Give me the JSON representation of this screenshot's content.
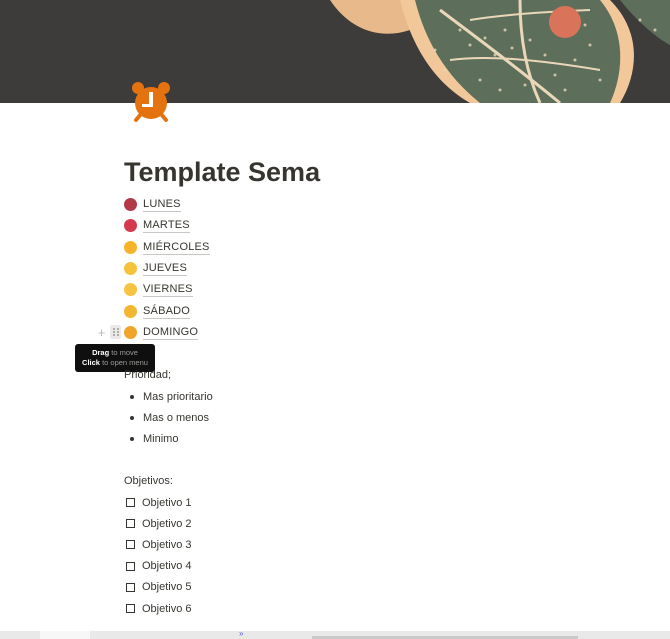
{
  "page": {
    "title": "Template Sema",
    "page_icon": "alarm-clock-icon"
  },
  "links": [
    {
      "label": "LUNES",
      "icon": "skull-emoji-icon",
      "color": "#b23a48"
    },
    {
      "label": "MARTES",
      "icon": "angry-face-emoji-icon",
      "color": "#d6384c"
    },
    {
      "label": "MIÉRCOLES",
      "icon": "hot-face-emoji-icon",
      "color": "#f7b32b"
    },
    {
      "label": "JUEVES",
      "icon": "relieved-face-emoji-icon",
      "color": "#f5c33b"
    },
    {
      "label": "VIERNES",
      "icon": "slightly-smiling-face-emoji-icon",
      "color": "#f6c342"
    },
    {
      "label": "SÁBADO",
      "icon": "grinning-face-emoji-icon",
      "color": "#f2b632"
    },
    {
      "label": "DOMINGO",
      "icon": "star-struck-emoji-icon",
      "color": "#f0a52a"
    }
  ],
  "tooltip": {
    "line1_bold": "Drag",
    "line1_rest": " to move",
    "line2_bold": "Click",
    "line2_rest": " to open menu"
  },
  "priority": {
    "label": "Prioridad;",
    "items": [
      "Mas prioritario",
      "Mas o menos",
      "Minimo"
    ]
  },
  "objectives": {
    "label": "Objetivos:",
    "items": [
      "Objetivo 1",
      "Objetivo 2",
      "Objetivo 3",
      "Objetivo 4",
      "Objetivo 5",
      "Objetivo 6"
    ]
  },
  "bottom": {
    "chevron": "»"
  }
}
